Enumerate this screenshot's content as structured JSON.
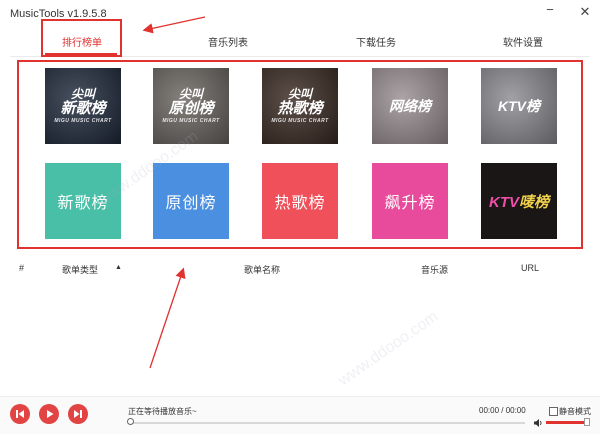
{
  "window": {
    "title": "MusicTools v1.9.5.8",
    "minimize_icon": "minimize-icon",
    "close_icon": "close-icon"
  },
  "tabs": [
    {
      "label": "排行榜单",
      "active": true
    },
    {
      "label": "音乐列表",
      "active": false
    },
    {
      "label": "下载任务",
      "active": false
    },
    {
      "label": "软件设置",
      "active": false
    }
  ],
  "charts": [
    {
      "lines": [
        "尖叫",
        "新歌榜",
        "MIGU MUSIC CHART"
      ],
      "style": "photo-dark",
      "bg": "#1f2a3c"
    },
    {
      "lines": [
        "尖叫",
        "原创榜",
        "MIGU MUSIC CHART"
      ],
      "style": "photo-dark",
      "bg": "#6a6661"
    },
    {
      "lines": [
        "尖叫",
        "热歌榜",
        "MIGU MUSIC CHART"
      ],
      "style": "photo-dark",
      "bg": "#3a2a22"
    },
    {
      "lines": [
        "网络榜"
      ],
      "style": "photo-light",
      "bg": "#9a8f93"
    },
    {
      "lines": [
        "KTV榜"
      ],
      "style": "photo-light",
      "bg": "#8d8c92"
    },
    {
      "lines": [
        "新歌榜"
      ],
      "style": "flat",
      "bg": "#48bfa6"
    },
    {
      "lines": [
        "原创榜"
      ],
      "style": "flat",
      "bg": "#4a8fe0"
    },
    {
      "lines": [
        "热歌榜"
      ],
      "style": "flat",
      "bg": "#f0505a"
    },
    {
      "lines": [
        "飙升榜"
      ],
      "style": "flat",
      "bg": "#e84a9c"
    },
    {
      "lines": [
        "KTV",
        "唛榜"
      ],
      "style": "ktv",
      "bg": "#1a1616",
      "colors": [
        "#ee4fa8",
        "#f0d14a"
      ]
    }
  ],
  "song_list": {
    "columns": [
      "#",
      "歌单类型",
      "歌单名称",
      "音乐源",
      "URL"
    ],
    "sort_icon": "sort-up-icon",
    "rows": []
  },
  "player": {
    "prev_icon": "previous-icon",
    "play_icon": "play-icon",
    "next_icon": "next-icon",
    "now_playing": "正在等待播放音乐~",
    "time": "00:00 / 00:00",
    "mute_label": "静音模式",
    "mute_checked": false,
    "speaker_icon": "speaker-icon"
  },
  "colors": {
    "accent": "#e0322f",
    "annotation": "#e0322f"
  }
}
